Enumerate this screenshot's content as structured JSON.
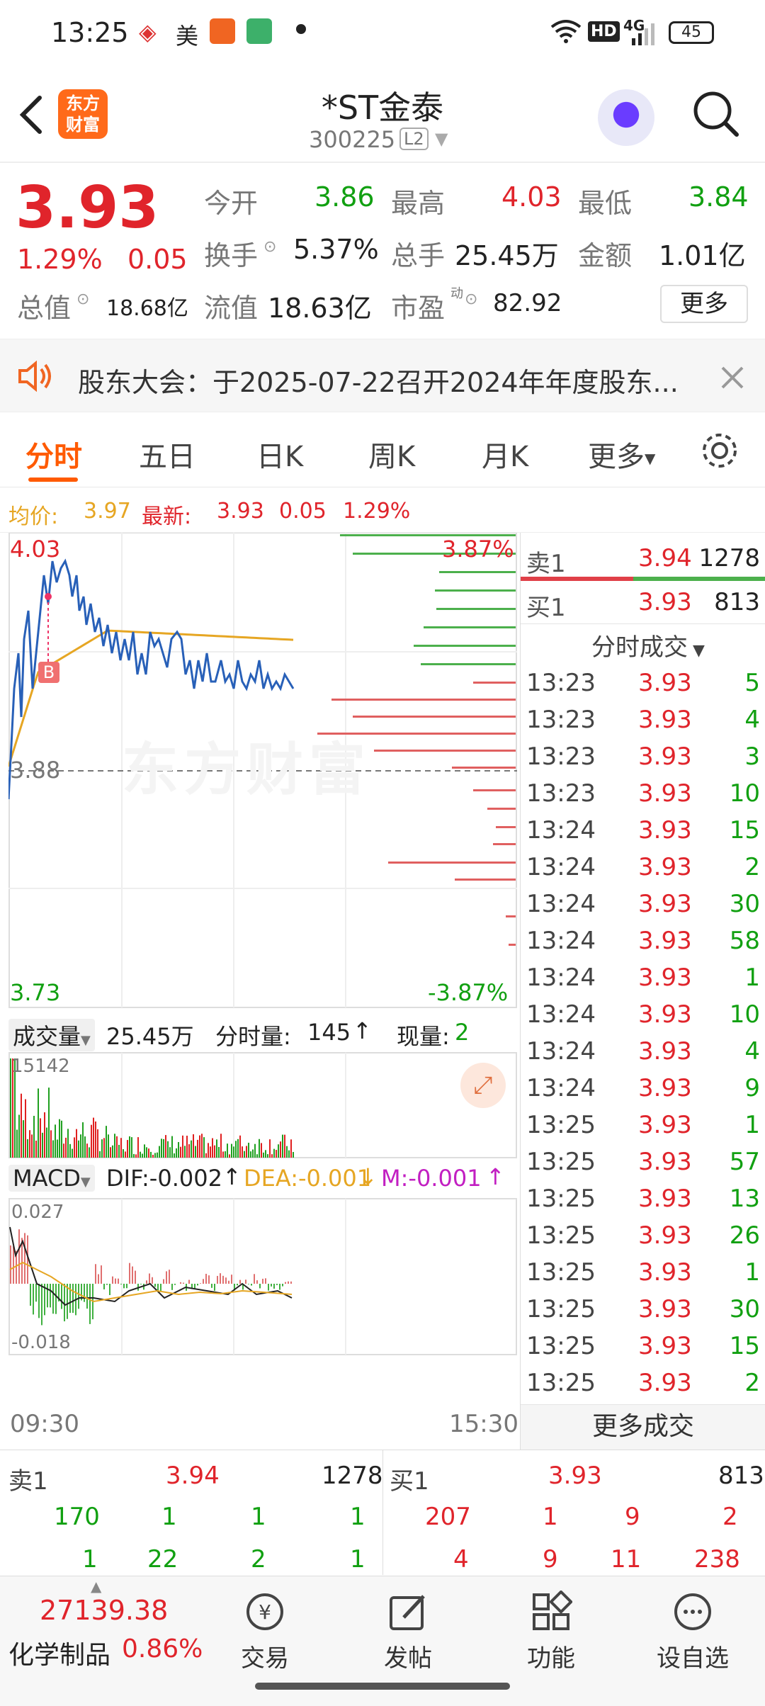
{
  "status_bar": {
    "time": "13:25",
    "mei": "美",
    "network": "4G",
    "hd": "HD",
    "battery": "45"
  },
  "header": {
    "logo_top": "东方",
    "logo_bottom": "财富",
    "title": "*ST金泰",
    "code": "300225",
    "level": "L2"
  },
  "quote": {
    "price": "3.93",
    "change_pct": "1.29%",
    "change": "0.05",
    "open_label": "今开",
    "open": "3.86",
    "high_label": "最高",
    "high": "4.03",
    "low_label": "最低",
    "low": "3.84",
    "turnover_label": "换手",
    "turnover": "5.37%",
    "volume_label": "总手",
    "volume": "25.45万",
    "amount_label": "金额",
    "amount": "1.01亿",
    "mktcap_label": "总值",
    "mktcap": "18.68亿",
    "float_label": "流值",
    "float": "18.63亿",
    "pe_label": "市盈",
    "pe_sup": "动",
    "pe": "82.92",
    "more": "更多"
  },
  "notice": {
    "text": "股东大会：于2025-07-22召开2024年年度股东..."
  },
  "tabs": {
    "t1": "分时",
    "t2": "五日",
    "t3": "日K",
    "t4": "周K",
    "t5": "月K",
    "t6": "更多"
  },
  "avg_bar": {
    "avg_label": "均价:",
    "avg": "3.97",
    "latest_label": "最新:",
    "latest": "3.93",
    "chg": "0.05",
    "pct": "1.29%"
  },
  "chart": {
    "top_price": "4.03",
    "top_pct": "3.87%",
    "mid_price": "3.88",
    "bottom_price": "3.73",
    "bottom_pct": "-3.87%",
    "b_marker": "B",
    "watermark": "东方财富",
    "vol_label": "成交量",
    "vol_total": "25.45万",
    "vol_fen_label": "分时量:",
    "vol_fen": "145",
    "vol_now_label": "现量:",
    "vol_now": "2",
    "vol_max": "15142",
    "macd_label": "MACD",
    "dif": "DIF:-0.002",
    "dea": "DEA:-0.001",
    "m": "M:-0.001",
    "macd_top": "0.027",
    "macd_bottom": "-0.018",
    "time_start": "09:30",
    "time_end": "15:30"
  },
  "trades": {
    "sell1_label": "卖1",
    "sell1_price": "3.94",
    "sell1_vol": "1278",
    "buy1_label": "买1",
    "buy1_price": "3.93",
    "buy1_vol": "813",
    "section": "分时成交",
    "more": "更多成交",
    "rows": [
      [
        "13:23",
        "3.93",
        "5"
      ],
      [
        "13:23",
        "3.93",
        "4"
      ],
      [
        "13:23",
        "3.93",
        "3"
      ],
      [
        "13:23",
        "3.93",
        "10"
      ],
      [
        "13:24",
        "3.93",
        "15"
      ],
      [
        "13:24",
        "3.93",
        "2"
      ],
      [
        "13:24",
        "3.93",
        "30"
      ],
      [
        "13:24",
        "3.93",
        "58"
      ],
      [
        "13:24",
        "3.93",
        "1"
      ],
      [
        "13:24",
        "3.93",
        "10"
      ],
      [
        "13:24",
        "3.93",
        "4"
      ],
      [
        "13:24",
        "3.93",
        "9"
      ],
      [
        "13:25",
        "3.93",
        "1"
      ],
      [
        "13:25",
        "3.93",
        "57"
      ],
      [
        "13:25",
        "3.93",
        "13"
      ],
      [
        "13:25",
        "3.93",
        "26"
      ],
      [
        "13:25",
        "3.93",
        "1"
      ],
      [
        "13:25",
        "3.93",
        "30"
      ],
      [
        "13:25",
        "3.93",
        "15"
      ],
      [
        "13:25",
        "3.93",
        "2"
      ]
    ]
  },
  "five": {
    "sell_label": "卖1",
    "sell_price": "3.94",
    "sell_vol": "1278",
    "buy_label": "买1",
    "buy_price": "3.93",
    "buy_vol": "813",
    "sell_row1": [
      "170",
      "1",
      "1",
      "1"
    ],
    "sell_row2": [
      "1",
      "22",
      "2",
      "1"
    ],
    "buy_row1": [
      "207",
      "1",
      "9",
      "2"
    ],
    "buy_row2": [
      "4",
      "9",
      "11",
      "238"
    ]
  },
  "nav": {
    "index_value": "27139.38",
    "index_name": "化学制品",
    "index_pct": "0.86%",
    "trade": "交易",
    "post": "发帖",
    "func": "功能",
    "watch": "设自选"
  }
}
